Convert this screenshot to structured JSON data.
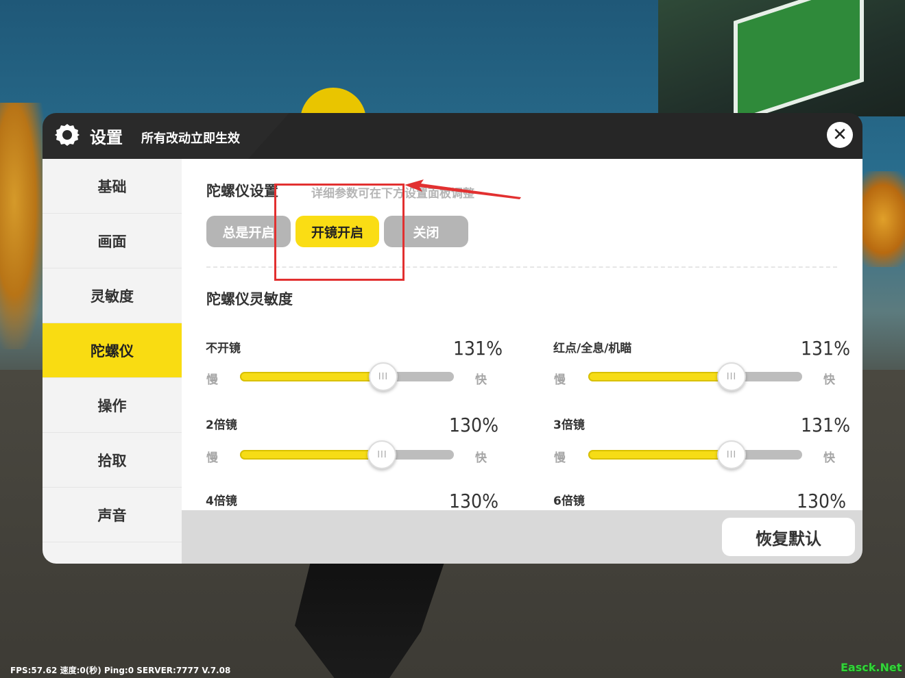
{
  "header": {
    "title": "设置",
    "subtitle": "所有改动立即生效",
    "close_icon": "close-icon"
  },
  "sidebar": {
    "items": [
      {
        "label": "基础"
      },
      {
        "label": "画面"
      },
      {
        "label": "灵敏度"
      },
      {
        "label": "陀螺仪",
        "active": true
      },
      {
        "label": "操作"
      },
      {
        "label": "拾取"
      },
      {
        "label": "声音"
      }
    ]
  },
  "gyro": {
    "title": "陀螺仪设置",
    "hint": "详细参数可在下方设置面板调整",
    "options": [
      "总是开启",
      "开镜开启",
      "关闭"
    ],
    "selected": "开镜开启"
  },
  "sensitivity": {
    "title": "陀螺仪灵敏度",
    "slow_label": "慢",
    "fast_label": "快",
    "sliders": [
      {
        "label": "不开镜",
        "value": "131%",
        "fraction": 0.67
      },
      {
        "label": "红点/全息/机瞄",
        "value": "131%",
        "fraction": 0.67
      },
      {
        "label": "2倍镜",
        "value": "130%",
        "fraction": 0.665
      },
      {
        "label": "3倍镜",
        "value": "131%",
        "fraction": 0.67
      },
      {
        "label": "4倍镜",
        "value": "130%"
      },
      {
        "label": "6倍镜",
        "value": "130%"
      }
    ]
  },
  "footer": {
    "reset_label": "恢复默认"
  },
  "status_bar": "FPS:57.62 速度:0(秒) Ping:0 SERVER:7777 V.7.08",
  "watermark": "Easck.Net",
  "colors": {
    "accent": "#FADD14",
    "header_bg": "#2A2A2A",
    "annotation": "#E23030"
  }
}
